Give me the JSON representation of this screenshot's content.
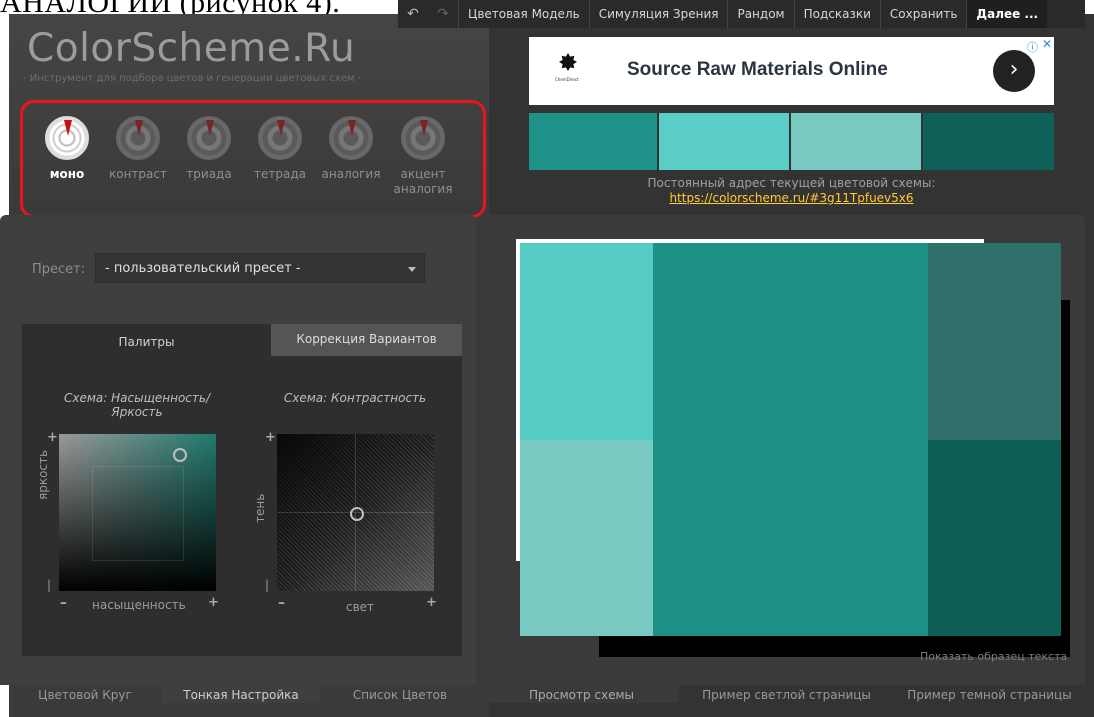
{
  "document": {
    "visible_text": "АНАЛОГИИ (рисунок 4)."
  },
  "topnav": {
    "items": [
      "Цветовая Модель",
      "Симуляция Зрения",
      "Рандом",
      "Подсказки",
      "Сохранить",
      "Далее ..."
    ]
  },
  "logo": {
    "title": "ColorScheme.Ru",
    "tagline": "- Инструмент для подбора цветов и генерации цветовых схем -"
  },
  "schemes": [
    {
      "label": "моно",
      "active": true
    },
    {
      "label": "контраст",
      "active": false
    },
    {
      "label": "триада",
      "active": false
    },
    {
      "label": "тетрада",
      "active": false
    },
    {
      "label": "аналогия",
      "active": false
    },
    {
      "label": "акцент аналогия",
      "active": false
    }
  ],
  "preset": {
    "label": "Пресет:",
    "value": "- пользовательский пресет -"
  },
  "inner_tabs": {
    "palettes": "Палитры",
    "correction": "Коррекция Вариантов"
  },
  "scheme_bright": {
    "title": "Схема: Насыщенность/Яркость",
    "y_label": "яркость",
    "x_label": "насыщенность",
    "plus": "+",
    "minus": "–"
  },
  "scheme_contrast": {
    "title": "Схема: Контрастность",
    "y_label": "тень",
    "x_label": "свет",
    "plus": "+",
    "minus": "–"
  },
  "bottom_left_tabs": [
    "Цветовой Круг",
    "Тонкая Настройка",
    "Список Цветов"
  ],
  "ad": {
    "headline": "Source Raw Materials Online",
    "logo_text": "ChemDirect",
    "arrow": "›",
    "info": "ⓘ",
    "close": "✕"
  },
  "palette_colors": [
    "#1f9389",
    "#5acec6",
    "#78c9c2",
    "#0d6159"
  ],
  "permalink": {
    "label": "Постоянный адрес текущей цветовой схемы:",
    "url": "https://colorscheme.ru/#3g11Tpfuev5x6"
  },
  "preview_colors": {
    "light_top": "#55ccc4",
    "light_bottom": "#77c9c2",
    "main": "#1e9186",
    "dark_top": "#2e6f69",
    "dark_bottom": "#0c5e56"
  },
  "show_sample": "Показать образец текста",
  "bottom_right_tabs": [
    "Просмотр схемы",
    "Пример светлой страницы",
    "Пример темной страницы"
  ]
}
